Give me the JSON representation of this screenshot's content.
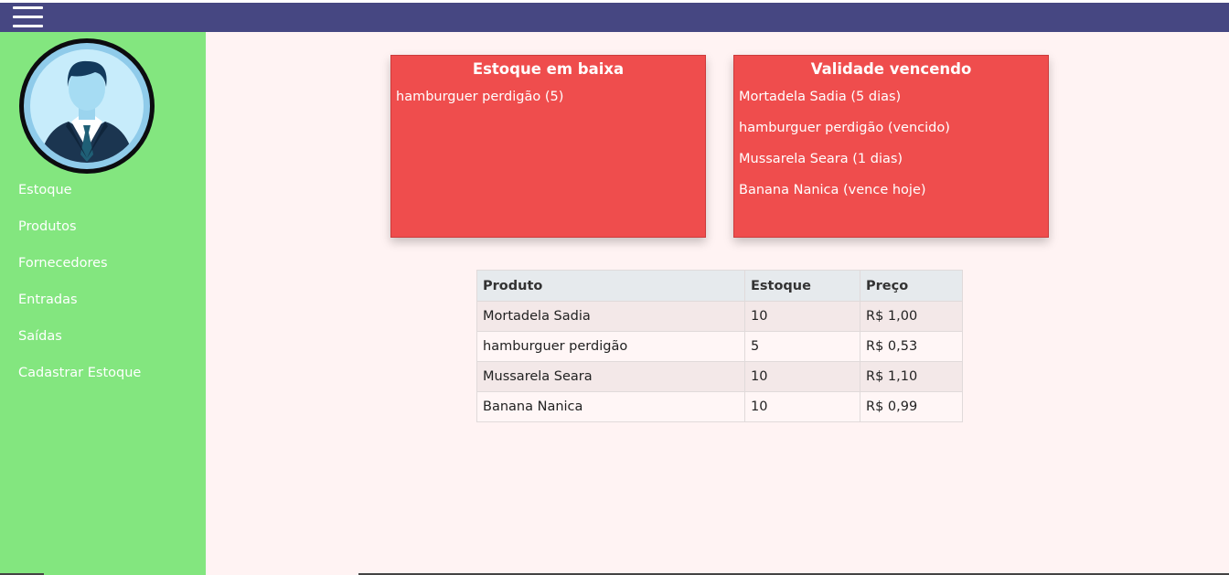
{
  "topbar": {
    "menu_icon": "hamburger-menu-icon",
    "color": "#464782"
  },
  "sidebar": {
    "color": "#83e67f",
    "avatar_icon": "user-avatar-icon",
    "items": [
      {
        "label": "Estoque"
      },
      {
        "label": "Produtos"
      },
      {
        "label": "Fornecedores"
      },
      {
        "label": "Entradas"
      },
      {
        "label": "Saídas"
      },
      {
        "label": "Cadastrar Estoque"
      }
    ]
  },
  "cards": {
    "color": "#ef4d4d",
    "low_stock": {
      "title": "Estoque em baixa",
      "items": [
        "hamburguer perdigão (5)"
      ]
    },
    "expiring": {
      "title": "Validade vencendo",
      "items": [
        "Mortadela Sadia (5 dias)",
        "hamburguer perdigão (vencido)",
        "Mussarela Seara (1 dias)",
        "Banana Nanica (vence hoje)"
      ]
    }
  },
  "table": {
    "headers": [
      "Produto",
      "Estoque",
      "Preço"
    ],
    "rows": [
      [
        "Mortadela Sadia",
        "10",
        "R$ 1,00"
      ],
      [
        "hamburguer perdigão",
        "5",
        "R$ 0,53"
      ],
      [
        "Mussarela Seara",
        "10",
        "R$ 1,10"
      ],
      [
        "Banana Nanica",
        "10",
        "R$ 0,99"
      ]
    ]
  }
}
